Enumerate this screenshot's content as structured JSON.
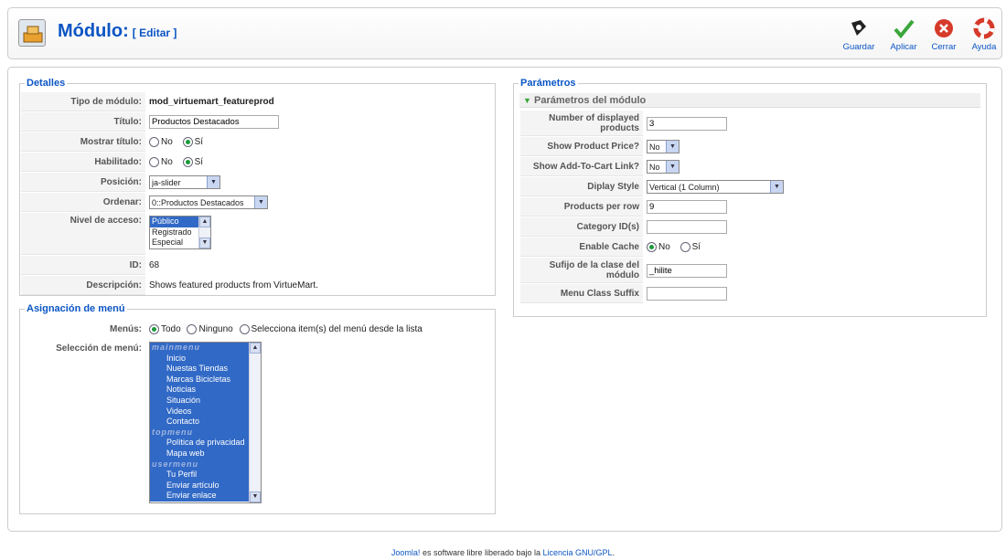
{
  "header": {
    "title": "Módulo:",
    "subtitle": "[ Editar ]",
    "toolbar": {
      "save": "Guardar",
      "apply": "Aplicar",
      "close": "Cerrar",
      "help": "Ayuda"
    }
  },
  "details": {
    "legend": "Detalles",
    "module_type_label": "Tipo de módulo:",
    "module_type_value": "mod_virtuemart_featureprod",
    "title_label": "Título:",
    "title_value": "Productos Destacados",
    "show_title_label": "Mostrar título:",
    "enabled_label": "Habilitado:",
    "radio_no": "No",
    "radio_yes": "Sí",
    "position_label": "Posición:",
    "position_value": "ja-slider",
    "order_label": "Ordenar:",
    "order_value": "0::Productos Destacados",
    "access_label": "Nivel de acceso:",
    "access_options": [
      "Público",
      "Registrado",
      "Especial"
    ],
    "id_label": "ID:",
    "id_value": "68",
    "description_label": "Descripción:",
    "description_value": "Shows featured products from VirtueMart."
  },
  "menu_assignment": {
    "legend": "Asignación de menú",
    "menus_label": "Menús:",
    "option_all": "Todo",
    "option_none": "Ninguno",
    "option_select": "Selecciona item(s) del menú desde la lista",
    "selection_label": "Selección de menú:",
    "items": [
      {
        "text": "mainmenu",
        "group": true
      },
      {
        "text": "Inicio",
        "group": false
      },
      {
        "text": "Nuestas Tiendas",
        "group": false
      },
      {
        "text": "Marcas Bicicletas",
        "group": false
      },
      {
        "text": "Noticias",
        "group": false
      },
      {
        "text": "Situación",
        "group": false
      },
      {
        "text": "Videos",
        "group": false
      },
      {
        "text": "Contacto",
        "group": false
      },
      {
        "text": "topmenu",
        "group": true
      },
      {
        "text": "Política de privacidad",
        "group": false
      },
      {
        "text": "Mapa web",
        "group": false
      },
      {
        "text": "usermenu",
        "group": true
      },
      {
        "text": "Tu Perfil",
        "group": false
      },
      {
        "text": "Enviar artículo",
        "group": false
      },
      {
        "text": "Enviar enlace",
        "group": false
      }
    ]
  },
  "parameters": {
    "legend": "Parámetros",
    "panel_title": "Parámetros del módulo",
    "num_products_label": "Number of displayed products",
    "num_products_value": "3",
    "show_price_label": "Show Product Price?",
    "show_price_value": "No",
    "show_cart_label": "Show Add-To-Cart Link?",
    "show_cart_value": "No",
    "display_style_label": "Diplay Style",
    "display_style_value": "Vertical (1 Column)",
    "per_row_label": "Products per row",
    "per_row_value": "9",
    "category_label": "Category ID(s)",
    "category_value": "",
    "cache_label": "Enable Cache",
    "cache_no": "No",
    "cache_yes": "Sí",
    "suffix_label": "Sufijo de la clase del módulo",
    "suffix_value": "_hilite",
    "menu_suffix_label": "Menu Class Suffix",
    "menu_suffix_value": ""
  },
  "footer": {
    "brand": "Joomla!",
    "text": " es software libre liberado bajo la ",
    "license": "Licencia GNU/GPL",
    "end": "."
  },
  "colors": {
    "accent": "#0b55c4",
    "selection": "#3169c6",
    "apply_green": "#3aa63a",
    "close_red": "#d63a2a"
  }
}
